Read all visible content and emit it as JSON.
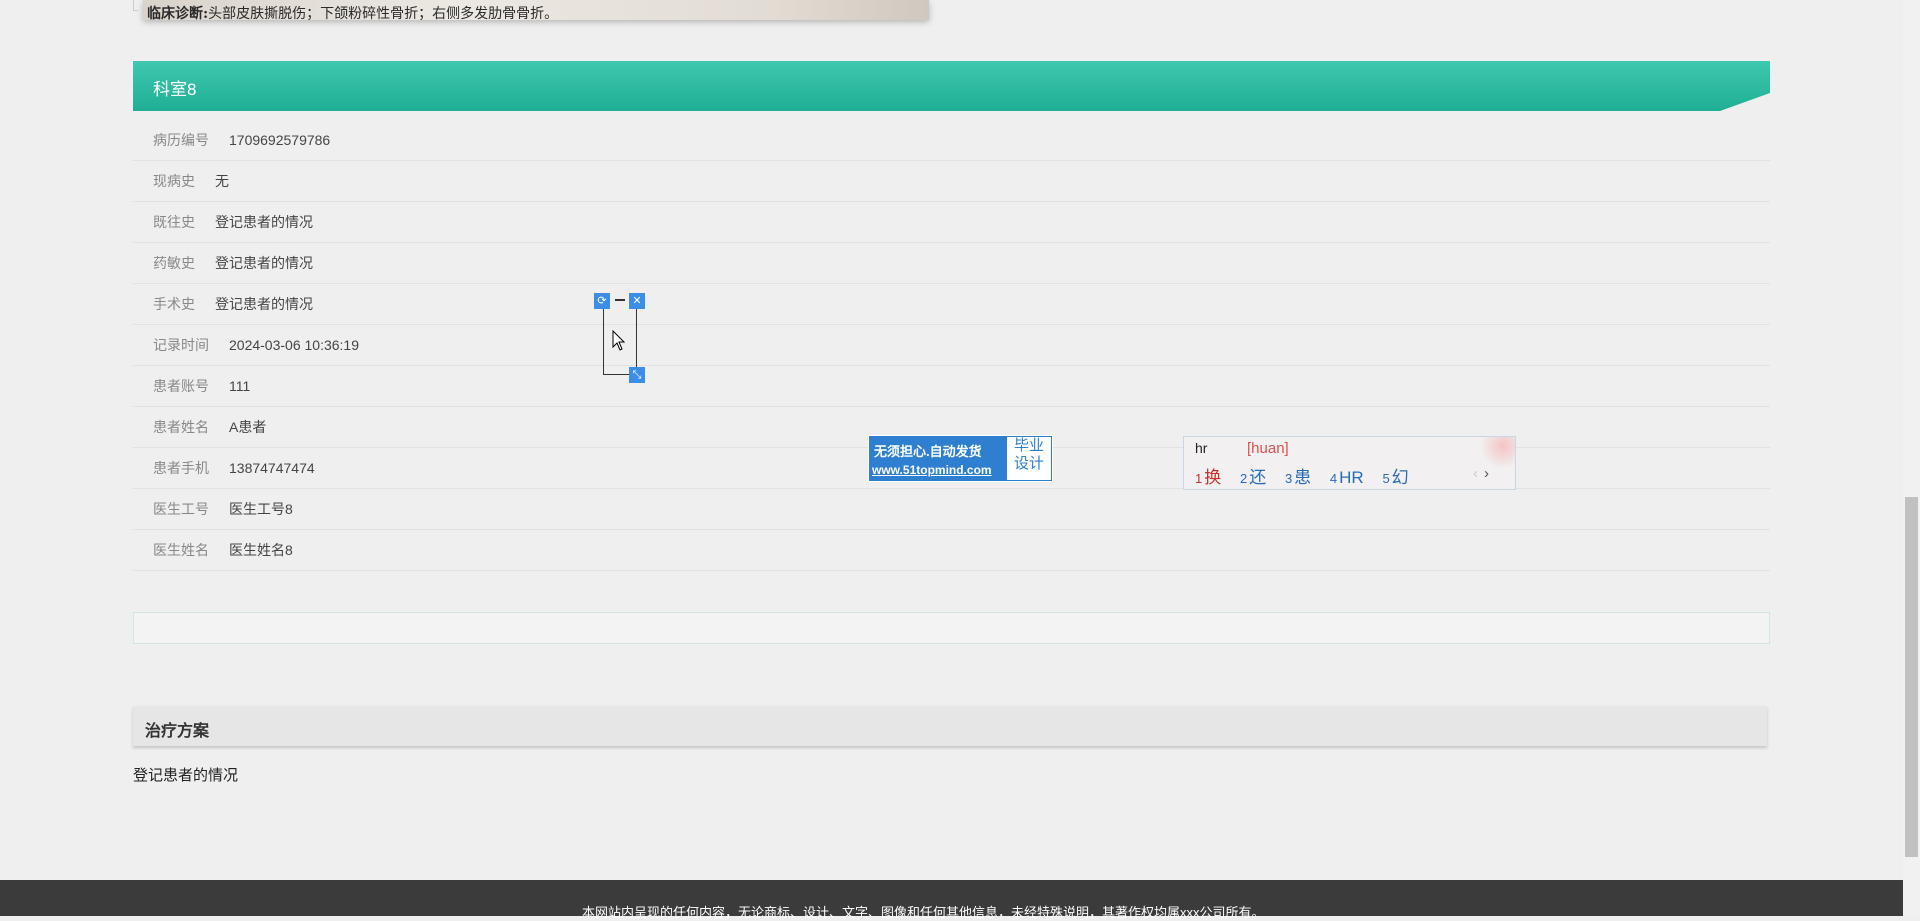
{
  "top_image": {
    "label_bold": "临床诊断:",
    "label_text": "头部皮肤撕脱伤；下颌粉碎性骨折；右侧多发肋骨骨折。"
  },
  "department": {
    "title": "科室8"
  },
  "info_rows": [
    {
      "label": "病历编号",
      "value": "1709692579786"
    },
    {
      "label": "现病史",
      "value": "无"
    },
    {
      "label": "既往史",
      "value": "登记患者的情况"
    },
    {
      "label": "药敏史",
      "value": "登记患者的情况"
    },
    {
      "label": "手术史",
      "value": "登记患者的情况"
    },
    {
      "label": "记录时间",
      "value": "2024-03-06 10:36:19"
    },
    {
      "label": "患者账号",
      "value": "111"
    },
    {
      "label": "患者姓名",
      "value": "A患者"
    },
    {
      "label": "患者手机",
      "value": "13874747474"
    },
    {
      "label": "医生工号",
      "value": "医生工号8"
    },
    {
      "label": "医生姓名",
      "value": "医生姓名8"
    }
  ],
  "treatment": {
    "title": "治疗方案",
    "text": "登记患者的情况"
  },
  "footer": {
    "text": "本网站内呈现的任何内容，无论商标、设计、文字、图像和任何其他信息，未经特殊说明，其著作权均属xxx公司所有。"
  },
  "ad": {
    "line1": "无须担心.自动发货",
    "line2": "www.51topmind.com",
    "side_line1": "毕业",
    "side_line2": "设计"
  },
  "ime": {
    "typed": "hr",
    "pinyin": "[huan]",
    "candidates": [
      {
        "num": "1",
        "text": "换"
      },
      {
        "num": "2",
        "text": "还"
      },
      {
        "num": "3",
        "text": "患"
      },
      {
        "num": "4",
        "text": "HR"
      },
      {
        "num": "5",
        "text": "幻"
      }
    ],
    "prev": "‹",
    "next": "›"
  },
  "snip_tool": {
    "refresh_glyph": "⟳",
    "close_glyph": "✕",
    "resize_glyph": "⤡"
  },
  "colors": {
    "header_teal": "#1fae94",
    "footer_bg": "#3b3b3b",
    "ad_blue": "#2e7fcf"
  }
}
